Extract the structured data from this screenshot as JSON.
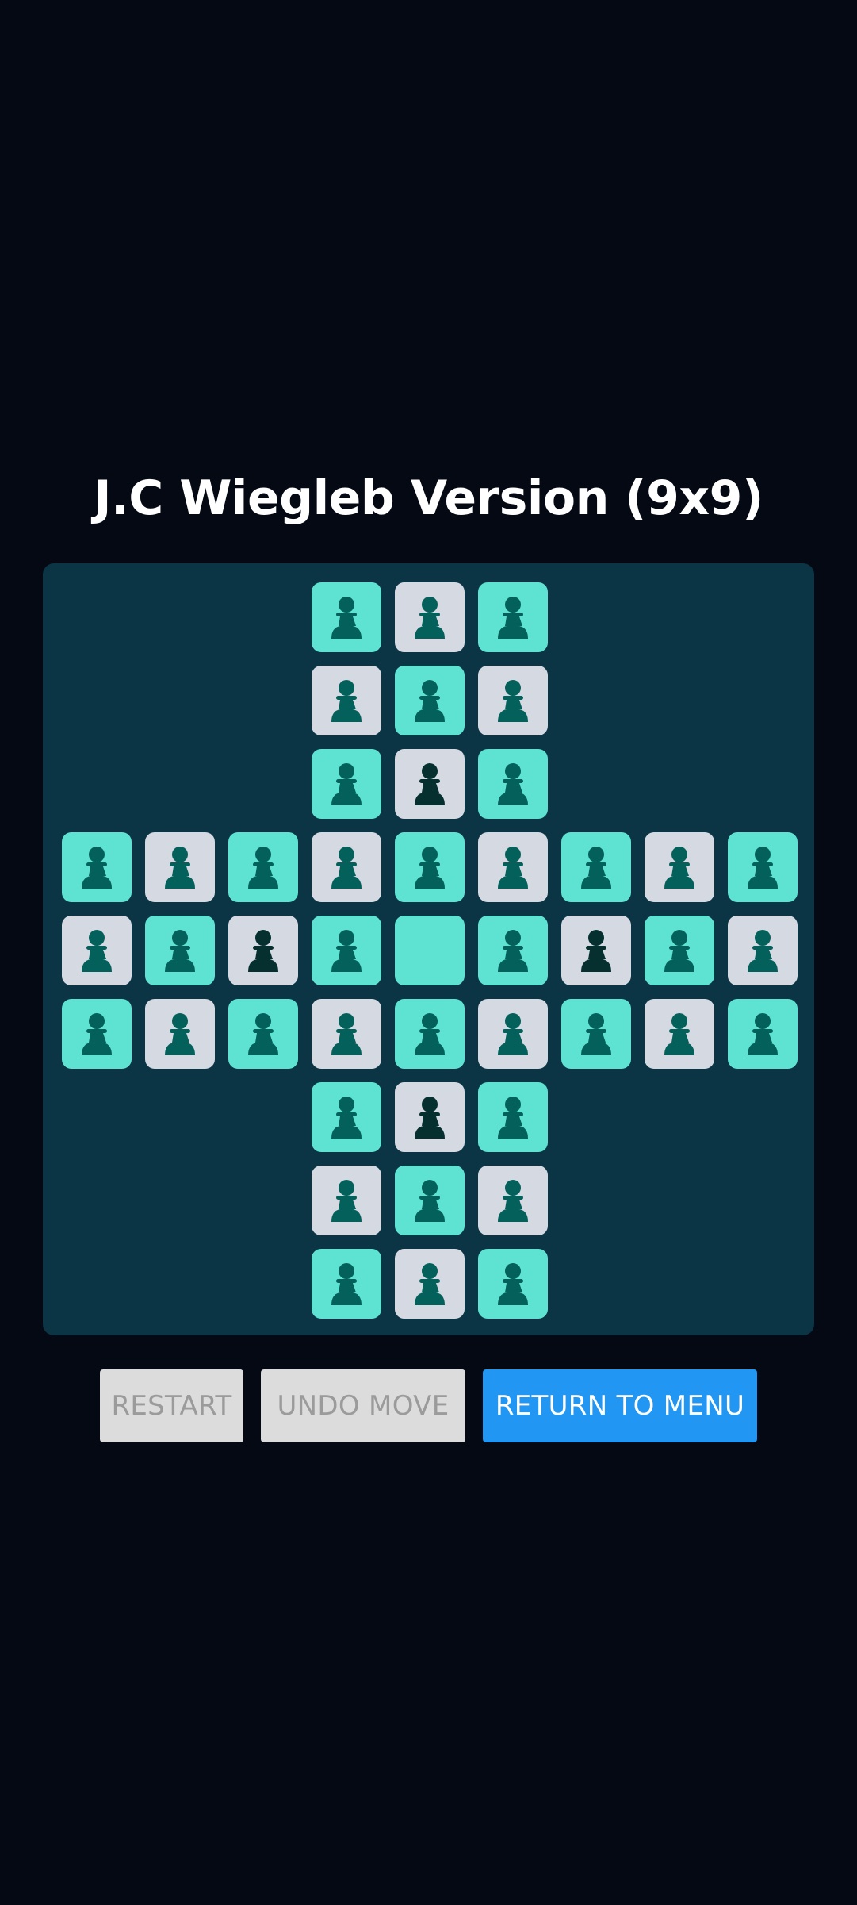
{
  "title": "J.C Wiegleb Version (9x9)",
  "colors": {
    "background": "#050913",
    "board": "#0b3445",
    "cell_light": "#d5d9e1",
    "cell_teal": "#5ee3d2",
    "peg": "#04605a",
    "peg_selected": "#06302f",
    "button_disabled": "#dcdcdc",
    "button_primary": "#2196f3"
  },
  "board": {
    "size": 9,
    "legend": {
      "X": "invalid",
      "P": "peg",
      "S": "peg-dark",
      "E": "empty"
    },
    "grid": [
      "XXXPPPXXX",
      "XXXPPPXXX",
      "XXXPSPXXX",
      "PPPPPPPPP",
      "PPSPEPSPP",
      "PPPPPPPPP",
      "XXXPSPXXX",
      "XXXPPPXXX",
      "XXXPPPXXX"
    ]
  },
  "buttons": {
    "restart": {
      "label": "RESTART",
      "enabled": false
    },
    "undo": {
      "label": "UNDO MOVE",
      "enabled": false
    },
    "menu": {
      "label": "RETURN TO MENU",
      "enabled": true
    }
  }
}
